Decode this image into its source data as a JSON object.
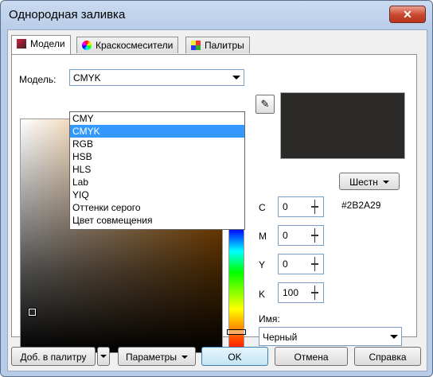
{
  "window": {
    "title": "Однородная заливка",
    "close_label": "✕"
  },
  "tabs": [
    {
      "label": "Модели"
    },
    {
      "label": "Краскосмесители"
    },
    {
      "label": "Палитры"
    }
  ],
  "model": {
    "label": "Модель:",
    "value": "CMYK",
    "options": [
      "CMY",
      "CMYK",
      "RGB",
      "HSB",
      "HLS",
      "Lab",
      "YIQ",
      "Оттенки серого",
      "Цвет совмещения"
    ],
    "selected_index": 1
  },
  "format": {
    "button_label": "Шестн",
    "hex_value": "#2B2A29"
  },
  "channels": [
    {
      "label": "C",
      "value": "0"
    },
    {
      "label": "M",
      "value": "0"
    },
    {
      "label": "Y",
      "value": "0"
    },
    {
      "label": "K",
      "value": "100"
    }
  ],
  "name": {
    "label": "Имя:",
    "value": "Черный"
  },
  "preview_color": "#2B2A29",
  "footer": {
    "add_to_palette": "Доб. в палитру",
    "options": "Параметры",
    "ok": "OK",
    "cancel": "Отмена",
    "help": "Справка"
  }
}
